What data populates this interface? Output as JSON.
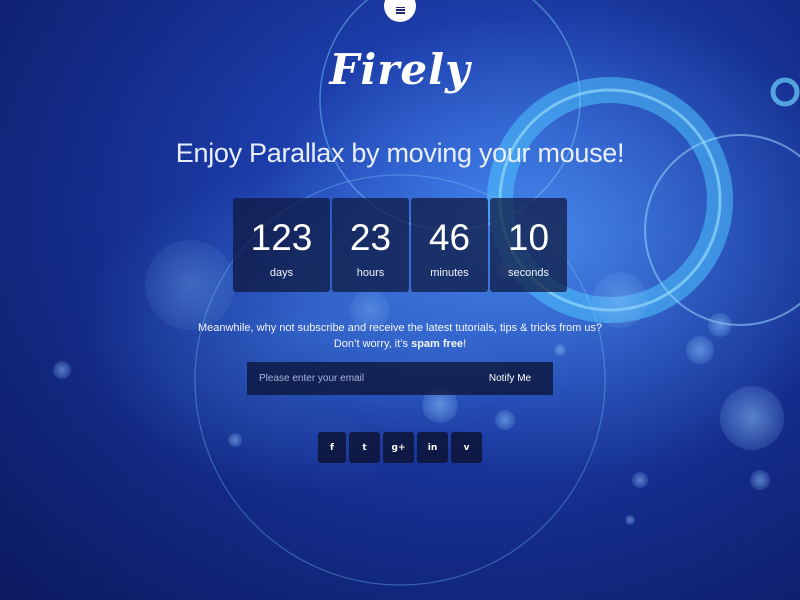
{
  "brand": {
    "logo": "Firely",
    "tagline": "Enjoy Parallax by moving your mouse!"
  },
  "menu": {
    "icon": "hamburger-menu-icon"
  },
  "countdown": [
    {
      "value": "123",
      "label": "days"
    },
    {
      "value": "23",
      "label": "hours"
    },
    {
      "value": "46",
      "label": "minutes"
    },
    {
      "value": "10",
      "label": "seconds"
    }
  ],
  "subscribe": {
    "line1": "Meanwhile, why not subscribe and receive the latest tutorials, tips & tricks from us?",
    "line2_prefix": "Don’t worry, it’s ",
    "line2_bold": "spam free",
    "line2_suffix": "!",
    "placeholder": "Please enter your email",
    "button_label": "Notify Me"
  },
  "social": [
    {
      "icon": "facebook-icon",
      "glyph": "f"
    },
    {
      "icon": "twitter-icon",
      "glyph": "t"
    },
    {
      "icon": "google-plus-icon",
      "glyph": "g+"
    },
    {
      "icon": "linkedin-icon",
      "glyph": "in"
    },
    {
      "icon": "vimeo-icon",
      "glyph": "v"
    }
  ],
  "colors": {
    "background_dark": "#0c1a5e",
    "background_mid": "#1b3ba6",
    "glow": "#4fc3ff",
    "panel": "#0e163c",
    "text": "#ffffff"
  }
}
